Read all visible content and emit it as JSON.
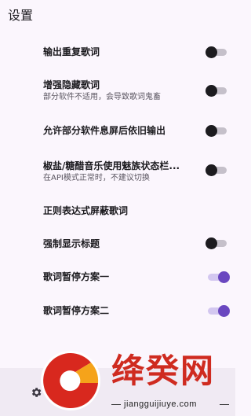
{
  "header": {
    "title": "设置"
  },
  "settings": [
    {
      "title": "输出重复歌词",
      "subtitle": "",
      "toggle": "off"
    },
    {
      "title": "增强隐藏歌词",
      "subtitle": "部分软件不适用，会导致歌词鬼畜",
      "toggle": "off"
    },
    {
      "title": "允许部分软件息屏后依旧输出",
      "subtitle": "",
      "toggle": "off"
    },
    {
      "title": "椒盐/糖醋音乐使用魅族状态栏...",
      "subtitle": "在API模式正常时，不建议切换",
      "toggle": "off"
    },
    {
      "title": "正则表达式屏蔽歌词",
      "subtitle": "",
      "toggle": "none"
    },
    {
      "title": "强制显示标题",
      "subtitle": "",
      "toggle": "off"
    },
    {
      "title": "歌词暂停方案一",
      "subtitle": "",
      "toggle": "on"
    },
    {
      "title": "歌词暂停方案二",
      "subtitle": "",
      "toggle": "on"
    }
  ],
  "bottom_nav": {
    "icon": "gear-icon"
  },
  "watermark": {
    "name": "绛癸网",
    "url": "jiangguijiuye.com"
  },
  "colors": {
    "background": "#fbf6fd",
    "accent": "#6a47c0",
    "switch_off_thumb": "#1c1b1f",
    "watermark_red": "#cf2b20"
  }
}
